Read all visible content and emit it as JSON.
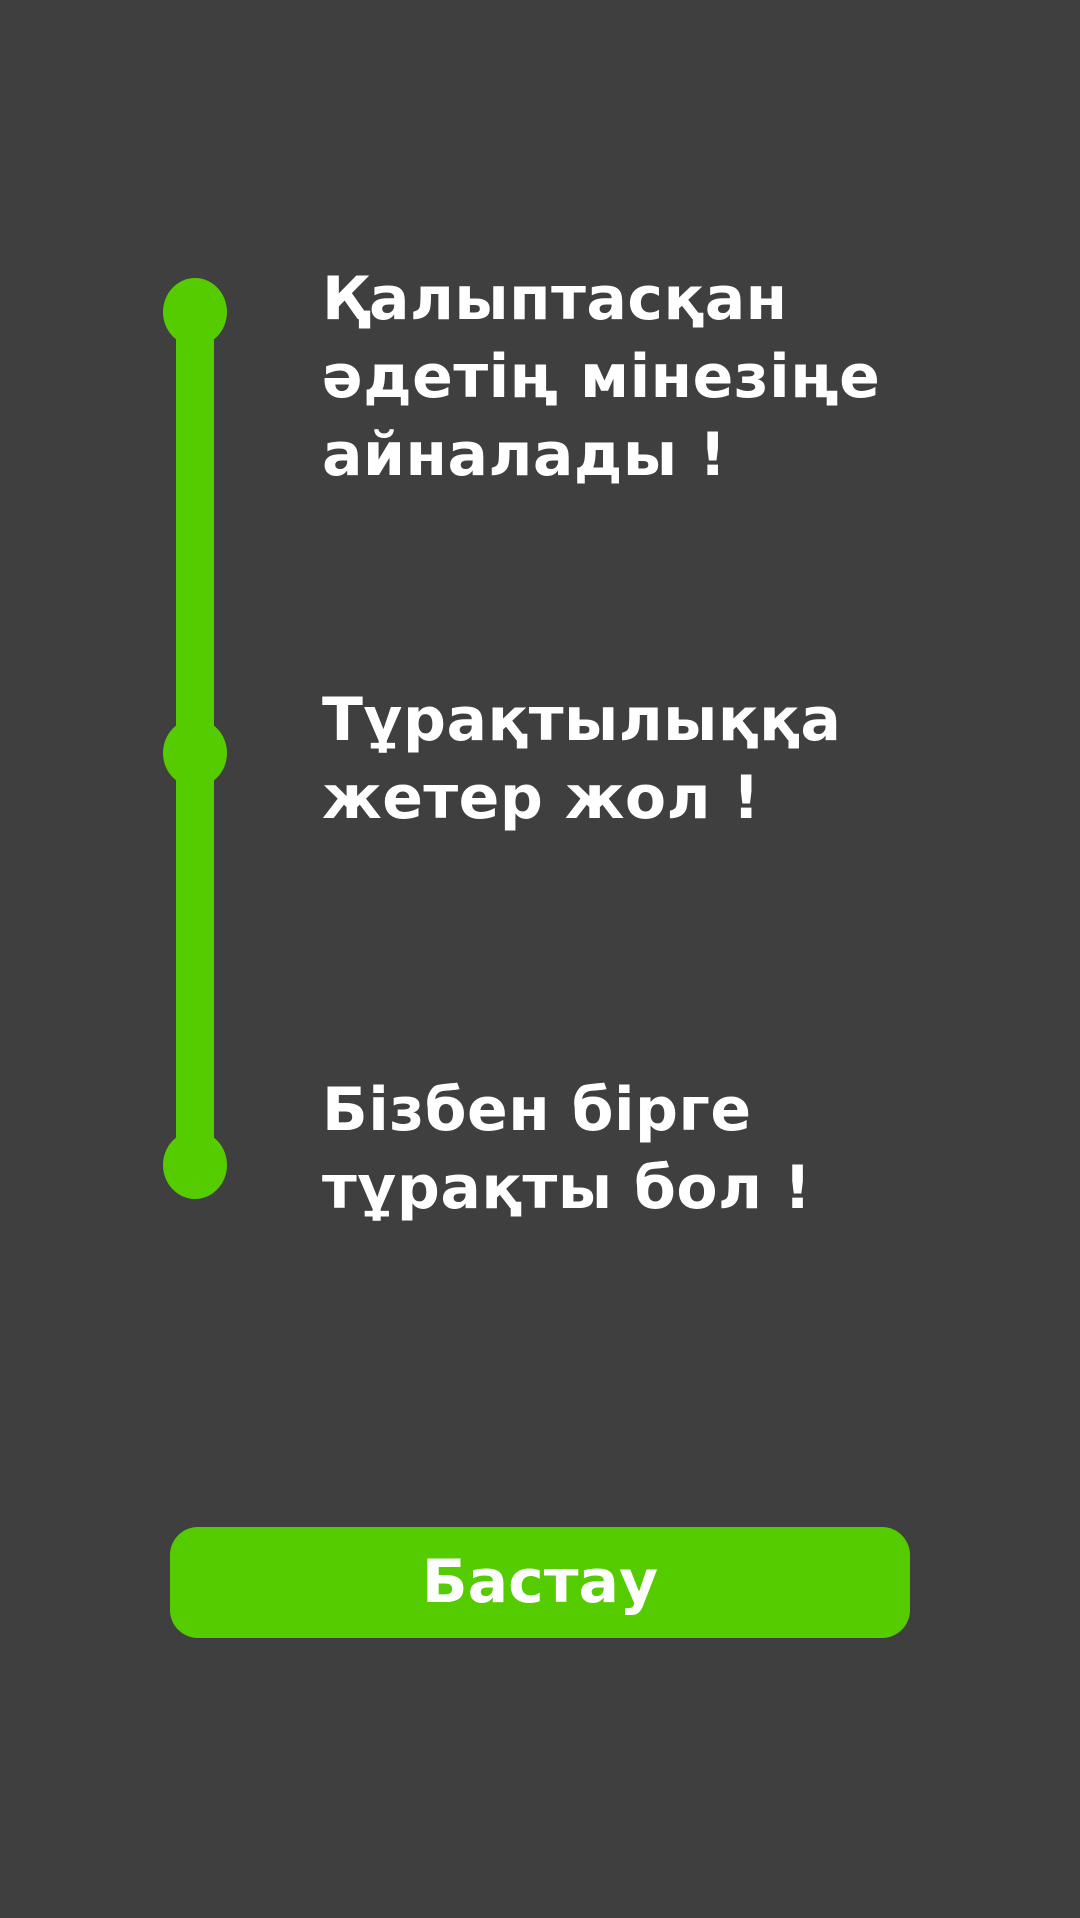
{
  "colors": {
    "background": "#3f3f3f",
    "accent": "#55cc00",
    "text": "#ffffff"
  },
  "steps": [
    {
      "text": "Қалыптасқан\nәдетің мінезіңе\nайналады !"
    },
    {
      "text": "Тұрақтылыққа\nжетер жол !"
    },
    {
      "text": "Бізбен бірге\nтұрақты бол !"
    }
  ],
  "start_button": {
    "label": "Бастау"
  }
}
